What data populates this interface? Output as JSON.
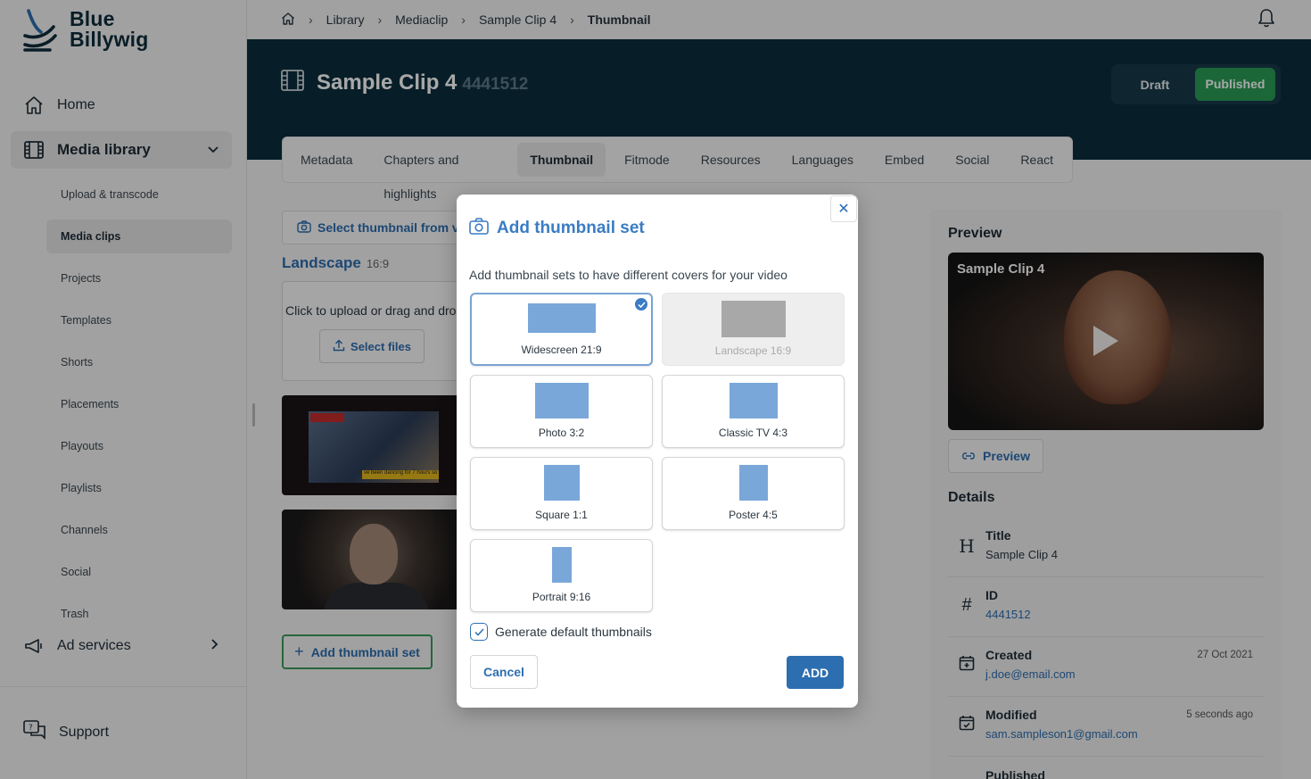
{
  "brand": {
    "line1": "Blue",
    "line2": "Billywig"
  },
  "sidebar": {
    "home": "Home",
    "media_library": "Media library",
    "items": [
      "Upload & transcode",
      "Media clips",
      "Projects",
      "Templates",
      "Shorts",
      "Placements",
      "Playouts",
      "Playlists",
      "Channels",
      "Social",
      "Trash"
    ],
    "active_item": "Media clips",
    "ad_services": "Ad services",
    "support": "Support"
  },
  "breadcrumb": [
    "Library",
    "Mediaclip",
    "Sample Clip 4",
    "Thumbnail"
  ],
  "header": {
    "title": "Sample Clip 4",
    "id": "4441512",
    "status_draft": "Draft",
    "status_published": "Published"
  },
  "tabs": [
    "Metadata",
    "Chapters and highlights",
    "Thumbnail",
    "Fitmode",
    "Resources",
    "Languages",
    "Embed",
    "Social",
    "React"
  ],
  "active_tab": "Thumbnail",
  "content": {
    "select_from_video": "Select thumbnail from video",
    "section_label": "Landscape",
    "section_ratio": "16:9",
    "upload_text": "Click to upload or drag and drop",
    "select_files": "Select files",
    "thumb_ticker": "ve been dancing for 7 hours so",
    "add_thumbnail_set": "Add thumbnail set"
  },
  "preview_panel": {
    "title": "Preview",
    "video_title": "Sample Clip 4",
    "preview_button": "Preview",
    "details_title": "Details",
    "details": [
      {
        "label": "Title",
        "value": "Sample Clip 4",
        "date": ""
      },
      {
        "label": "ID",
        "value": "4441512",
        "date": ""
      },
      {
        "label": "Created",
        "value": "j.doe@email.com",
        "date": "27 Oct 2021"
      },
      {
        "label": "Modified",
        "value": "sam.sampleson1@gmail.com",
        "date": "5 seconds ago"
      }
    ],
    "next_label": "Published"
  },
  "modal": {
    "title": "Add thumbnail set",
    "description": "Add thumbnail sets to have different covers for your video",
    "options": [
      {
        "label": "Widescreen 21:9",
        "state": "selected"
      },
      {
        "label": "Landscape 16:9",
        "state": "disabled"
      },
      {
        "label": "Photo 3:2",
        "state": "default"
      },
      {
        "label": "Classic TV 4:3",
        "state": "default"
      },
      {
        "label": "Square 1:1",
        "state": "default"
      },
      {
        "label": "Poster 4:5",
        "state": "default"
      },
      {
        "label": "Portrait 9:16",
        "state": "default"
      }
    ],
    "generate_default": "Generate default thumbnails",
    "generate_checked": true,
    "cancel": "Cancel",
    "add": "ADD"
  },
  "colors": {
    "brand_dark": "#0c2e3e",
    "accent_blue": "#2d6eb0",
    "published_green": "#2a9d55",
    "shape_blue": "#7aa7d9"
  }
}
